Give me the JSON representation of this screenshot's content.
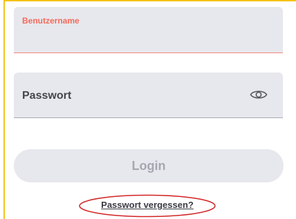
{
  "form": {
    "username": {
      "label": "Benutzername",
      "value": ""
    },
    "password": {
      "label": "Passwort",
      "toggle_icon": "eye-icon"
    },
    "login_label": "Login",
    "forgot_password_label": "Passwort vergessen?"
  },
  "colors": {
    "field_background": "#e7e8ed",
    "focus_accent": "#f46a5a",
    "frame_highlight": "#f5c318",
    "annotation_circle": "#d22222",
    "button_disabled_text": "#a5a8b0"
  }
}
